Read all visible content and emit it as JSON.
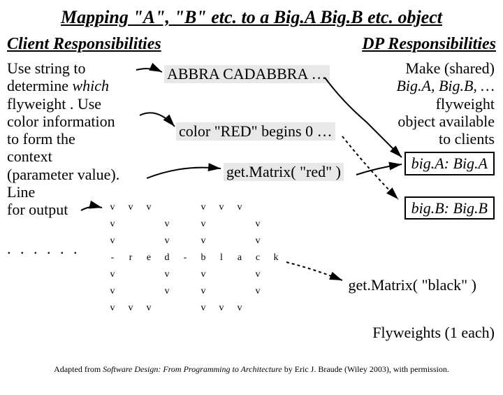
{
  "title": "Mapping \"A\", \"B\" etc.  to a Big.A Big.B etc. object",
  "subheads": {
    "left": "Client Responsibilities",
    "right": "DP Responsibilities"
  },
  "left": {
    "l1a": "Use string to",
    "l1b": "determine ",
    "l1bital": "which",
    "l1c": "flyweight .  Use",
    "l1d": "color information",
    "l1e": "to form the",
    "l1f": "context",
    "l1g": "(parameter value).",
    "l2a": "Line",
    "l2b": "for output",
    "dots": ". . . . . ."
  },
  "right": {
    "r1a": "Make (shared)",
    "r1b": "Big.A, Big.B, …",
    "r1c": "flyweight",
    "r1d": "object available",
    "r1e": "to clients",
    "boxA": "big.A: Big.A",
    "boxB": "big.B: Big.B"
  },
  "callouts": {
    "abbra": "ABBRA CADABBRA …",
    "red": "color \"RED\" begins 0 …",
    "gm1": "get.Matrix( \"red\" )",
    "gm2": "get.Matrix( \"black\" )"
  },
  "fly": "Flyweights (1 each)",
  "credit": {
    "pre": "Adapted from ",
    "book": "Software Design: From Programming to Architecture",
    "post": " by Eric J. Braude (Wiley 2003), with permission."
  },
  "matrix": [
    [
      "v",
      "v",
      "v",
      "",
      "",
      "v",
      "v",
      "v",
      "",
      ""
    ],
    [
      "v",
      "",
      "",
      "v",
      "",
      "v",
      "",
      "",
      "v",
      ""
    ],
    [
      "v",
      "",
      "",
      "v",
      "",
      "v",
      "",
      "",
      "v",
      ""
    ],
    [
      "-",
      "r",
      "e",
      "d",
      "-",
      "b",
      "l",
      "a",
      "c",
      "k"
    ],
    [
      "v",
      "",
      "",
      "v",
      "",
      "v",
      "",
      "",
      "v",
      ""
    ],
    [
      "v",
      "",
      "",
      "v",
      "",
      "v",
      "",
      "",
      "v",
      ""
    ],
    [
      "v",
      "v",
      "v",
      "",
      "",
      "v",
      "v",
      "v",
      "",
      ""
    ]
  ]
}
